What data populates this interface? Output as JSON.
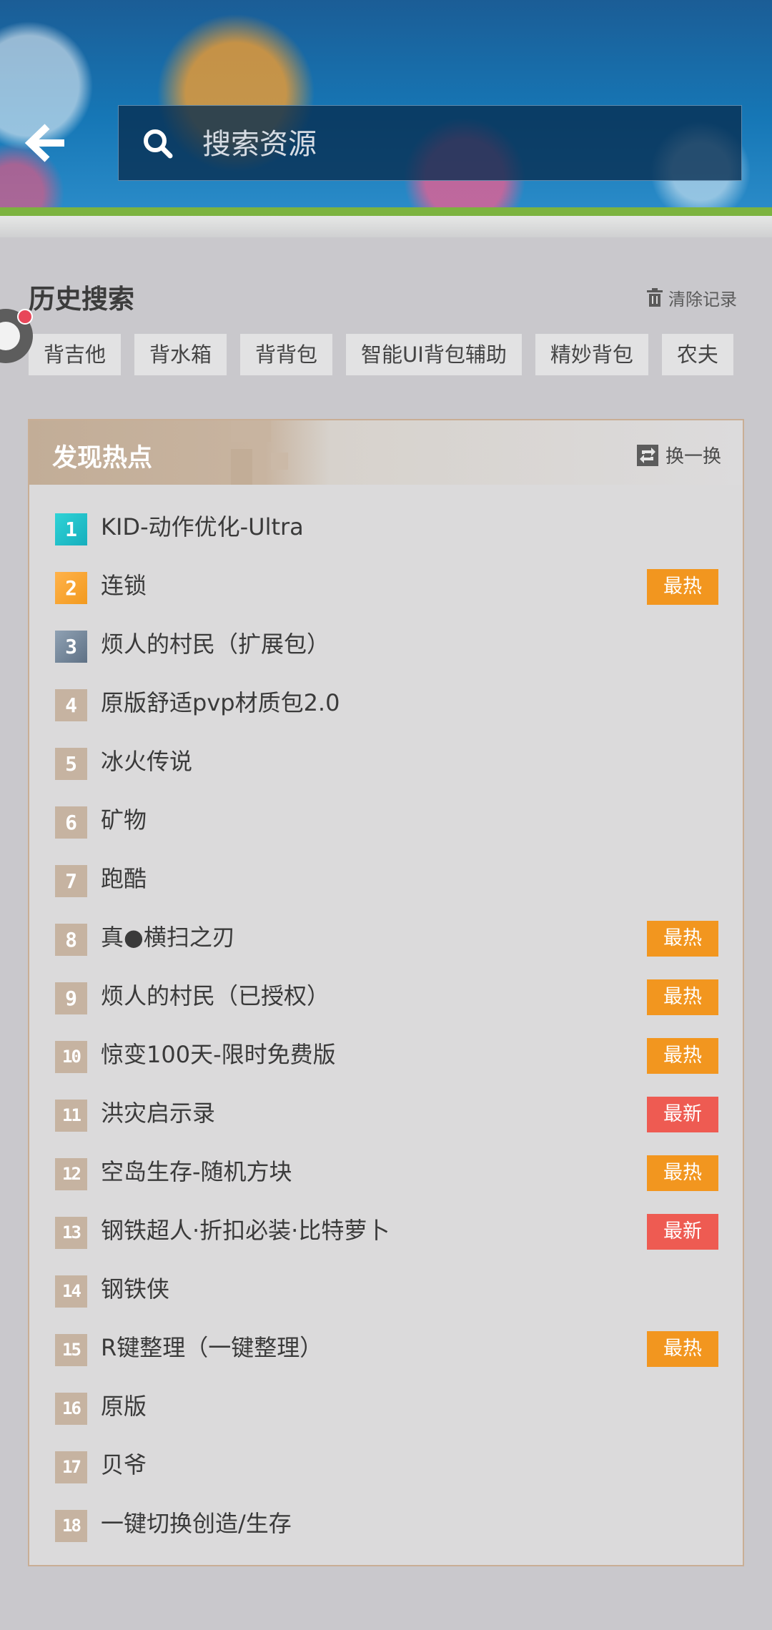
{
  "search": {
    "placeholder": "搜索资源",
    "value": ""
  },
  "history": {
    "title": "历史搜索",
    "clear_label": "清除记录",
    "tags": [
      "背吉他",
      "背水箱",
      "背背包",
      "智能UI背包辅助",
      "精妙背包",
      "农夫"
    ]
  },
  "hot": {
    "title": "发现热点",
    "refresh_label": "换一换",
    "items": [
      {
        "rank": "1",
        "text": "KID-动作优化-Ultra",
        "badge": ""
      },
      {
        "rank": "2",
        "text": "连锁",
        "badge": "最热"
      },
      {
        "rank": "3",
        "text": "烦人的村民（扩展包）",
        "badge": ""
      },
      {
        "rank": "4",
        "text": "原版舒适pvp材质包2.0",
        "badge": ""
      },
      {
        "rank": "5",
        "text": "冰火传说",
        "badge": ""
      },
      {
        "rank": "6",
        "text": "矿物",
        "badge": ""
      },
      {
        "rank": "7",
        "text": "跑酷",
        "badge": ""
      },
      {
        "rank": "8",
        "text": "真●横扫之刃",
        "badge": "最热"
      },
      {
        "rank": "9",
        "text": "烦人的村民（已授权）",
        "badge": "最热"
      },
      {
        "rank": "10",
        "text": "惊变100天-限时免费版",
        "badge": "最热"
      },
      {
        "rank": "11",
        "text": "洪灾启示录",
        "badge": "最新"
      },
      {
        "rank": "12",
        "text": "空岛生存-随机方块",
        "badge": "最热"
      },
      {
        "rank": "13",
        "text": "钢铁超人·折扣必装·比特萝卜",
        "badge": "最新"
      },
      {
        "rank": "14",
        "text": "钢铁侠",
        "badge": ""
      },
      {
        "rank": "15",
        "text": "R键整理（一键整理）",
        "badge": "最热"
      },
      {
        "rank": "16",
        "text": "原版",
        "badge": ""
      },
      {
        "rank": "17",
        "text": "贝爷",
        "badge": ""
      },
      {
        "rank": "18",
        "text": "一键切换创造/生存",
        "badge": ""
      }
    ]
  },
  "colors": {
    "badge_hot": "#f2961f",
    "badge_new": "#ee5b52",
    "rank_1": "#2fd3d6",
    "rank_2": "#f7a733",
    "rank_3": "#7a8c9f",
    "rank_other": "#c6b3a1",
    "header_green": "#7cb33f"
  },
  "icons": {
    "back": "arrow-left-icon",
    "search": "search-icon",
    "clear": "trash-icon",
    "refresh": "refresh-icon"
  }
}
